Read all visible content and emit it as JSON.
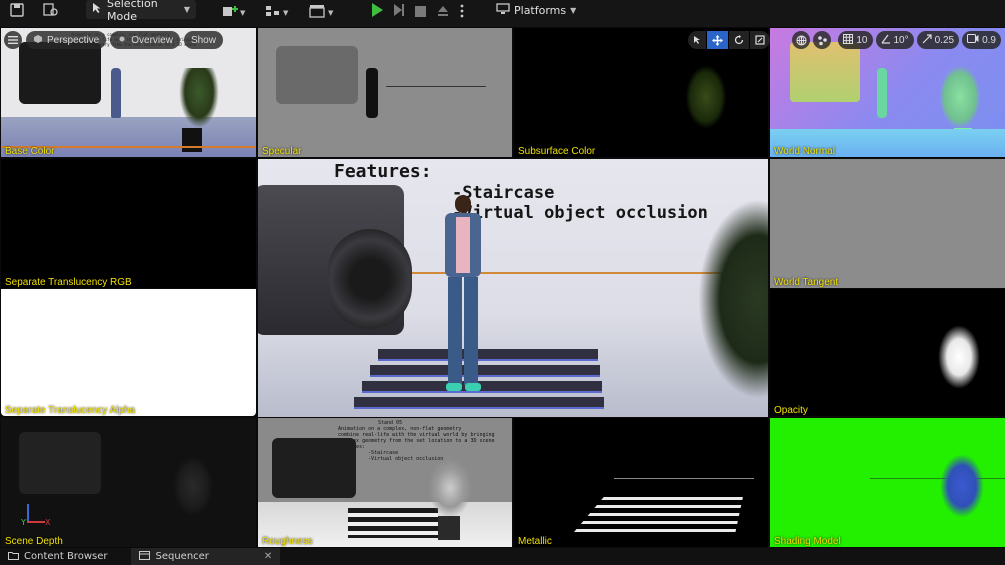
{
  "toolbar": {
    "selection_mode": "Selection Mode",
    "platforms": "Platforms"
  },
  "viewport_controls": {
    "perspective": "Perspective",
    "overview": "Overview",
    "show": "Show",
    "grid_snap": "10",
    "rotate_snap": "10°",
    "scale_snap": "0.25",
    "camera_speed": "0.9"
  },
  "buffers": {
    "base_color": "Base Color",
    "specular": "Specular",
    "subsurface_color": "Subsurface Color",
    "world_normal": "World Normal",
    "separate_translucency_rgb": "Separate Translucency RGB",
    "world_tangent": "World Tangent",
    "separate_translucency_alpha": "Separate Translucency Alpha",
    "opacity": "Opacity",
    "scene_depth": "Scene Depth",
    "roughness": "Roughness",
    "metallic": "Metallic",
    "shading_model": "Shading Model"
  },
  "scene_text": {
    "features": "Features:",
    "staircase": "-Staircase",
    "occlusion": "-Virtual object occlusion",
    "stand": "Stand 05",
    "line1": "Animation on a complex, non-flat geometry",
    "line2": "combine real-life with the virtual world by bringing",
    "line3": "complex geometry from the set location to a 3D scene",
    "line4": "Features:",
    "line5": "-Staircase",
    "line6": "-Virtual object occlusion"
  },
  "axes": {
    "y": "Y",
    "x": "X"
  },
  "tabs": {
    "content_browser": "Content Browser",
    "sequencer": "Sequencer"
  }
}
